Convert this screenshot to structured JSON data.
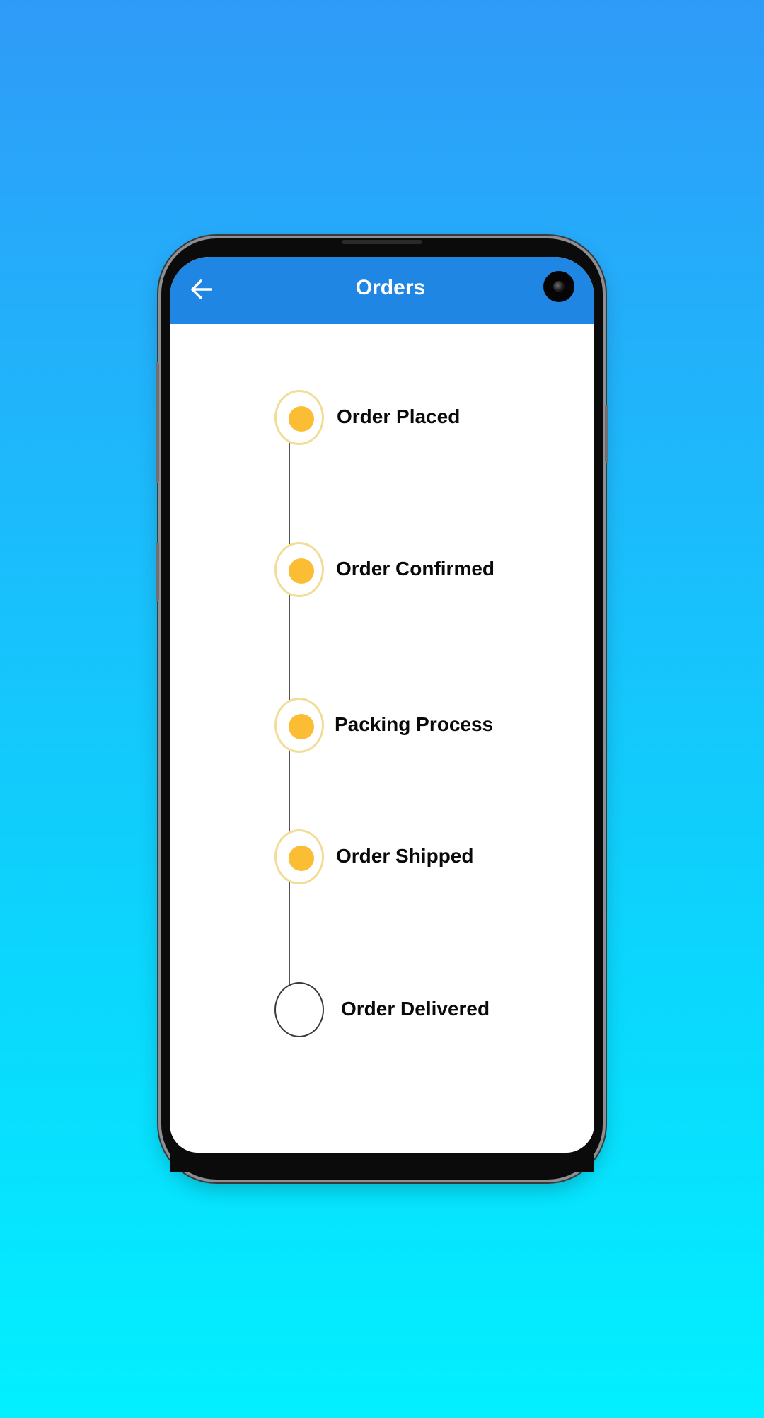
{
  "app_bar": {
    "title": "Orders",
    "back_icon": "arrow-left-icon",
    "background": "#1f86e3"
  },
  "steps": [
    {
      "label": "Order Placed",
      "status": "completed"
    },
    {
      "label": "Order Confirmed",
      "status": "completed"
    },
    {
      "label": "Packing Process",
      "status": "completed"
    },
    {
      "label": "Order Shipped",
      "status": "completed"
    },
    {
      "label": "Order Delivered",
      "status": "pending"
    }
  ],
  "colors": {
    "completed_dot": "#fbbd33",
    "completed_ring": "#f1dd98",
    "pending_ring": "#3a3a3a"
  }
}
